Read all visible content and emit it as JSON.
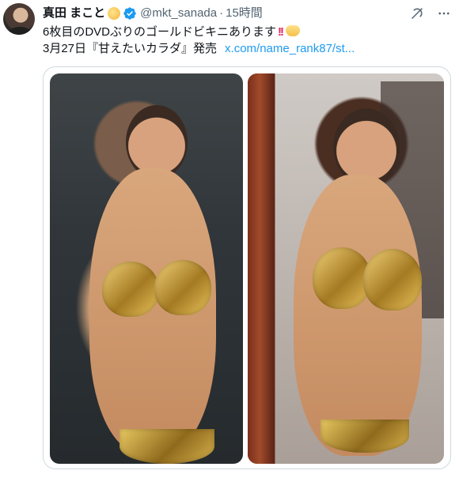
{
  "tweet": {
    "display_name": "真田 まこと",
    "handle": "@mkt_sanada",
    "separator": "·",
    "time": "15時間",
    "text_line1": "6枚目のDVDぶりのゴールドビキニあります",
    "text_line2_prefix": "3月27日『甘えたいカラダ』発売",
    "text_line2_link": "x.com/name_rank87/st...",
    "icons": {
      "name_badge": "sun-emoji-icon",
      "verified": "verified-badge-icon",
      "grok": "grok-icon",
      "more": "more-options-icon",
      "double_exclamation": "double-exclamation-emoji-icon",
      "wave": "wave-emoji-icon"
    },
    "colors": {
      "verified_blue": "#1d9bf0",
      "link_blue": "#1d9bf0",
      "secondary_text": "#536471",
      "border": "#cfd9de",
      "exclamation_red": "#e0245e"
    },
    "media": {
      "count": 2
    }
  }
}
